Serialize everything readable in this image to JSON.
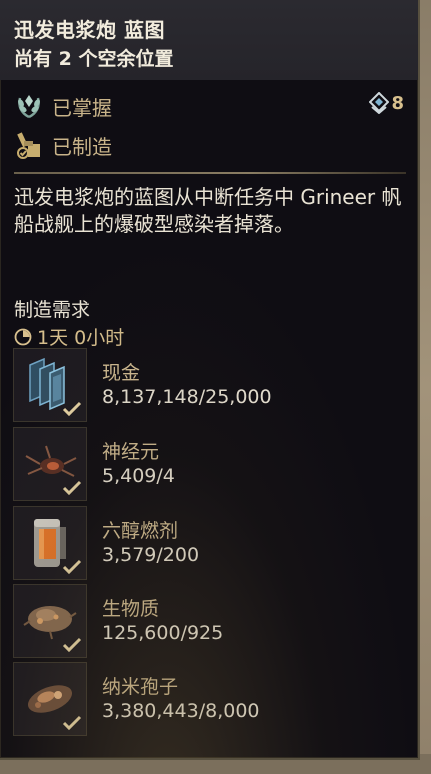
{
  "blueprint": {
    "title": "迅发电浆炮 蓝图",
    "slots_text": "尚有 2 个空余位置"
  },
  "status": {
    "mastered_label": "已掌握",
    "crafted_label": "已制造",
    "mastery_rank": "8"
  },
  "description": "迅发电浆炮的蓝图从中断任务中 Grineer 帆船战舰上的爆破型感染者掉落。",
  "requirements": {
    "title": "制造需求",
    "build_time": "1天 0小时",
    "items": [
      {
        "name": "现金",
        "count": "8,137,148/25,000",
        "icon": "credits-icon"
      },
      {
        "name": "神经元",
        "count": "5,409/4",
        "icon": "neurodes-icon"
      },
      {
        "name": "六醇燃剂",
        "count": "3,579/200",
        "icon": "hexenon-icon"
      },
      {
        "name": "生物质",
        "count": "125,600/925",
        "icon": "biomass-icon"
      },
      {
        "name": "纳米孢子",
        "count": "3,380,443/8,000",
        "icon": "nano-spores-icon"
      }
    ]
  },
  "colors": {
    "panel_bg": "#0f0d13",
    "header_bg": "#2b2a30",
    "gold_text": "#c9b48a",
    "check_color": "#e8d5a6"
  }
}
